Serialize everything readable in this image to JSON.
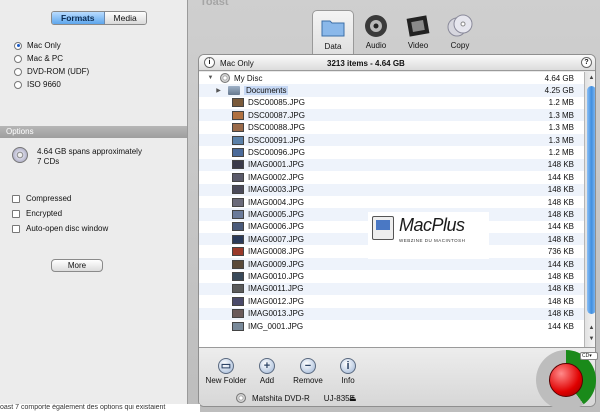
{
  "drawer": {
    "segments": [
      "Formats",
      "Media"
    ],
    "active_segment": "Formats",
    "formats": [
      {
        "label": "Mac Only",
        "selected": true
      },
      {
        "label": "Mac & PC",
        "selected": false
      },
      {
        "label": "DVD-ROM (UDF)",
        "selected": false
      },
      {
        "label": "ISO 9660",
        "selected": false
      }
    ],
    "options_title": "Options",
    "span_text": "4.64 GB spans approximately 7 CDs",
    "checks": [
      "Compressed",
      "Encrypted",
      "Auto-open disc window"
    ],
    "more_label": "More"
  },
  "caption": "oast 7 comporte également des options qui existaient",
  "window": {
    "title": "Toast",
    "tabs": [
      {
        "label": "Data",
        "icon": "folder-icon",
        "active": true
      },
      {
        "label": "Audio",
        "icon": "speaker-icon",
        "active": false
      },
      {
        "label": "Video",
        "icon": "film-icon",
        "active": false
      },
      {
        "label": "Copy",
        "icon": "discs-icon",
        "active": false
      }
    ]
  },
  "panel": {
    "format": "Mac Only",
    "summary": "3213 items - 4.64 GB",
    "help": "?",
    "info": "i"
  },
  "files": [
    {
      "name": "My Disc",
      "size": "4.64 GB",
      "kind": "disc"
    },
    {
      "name": "Documents",
      "size": "4.25 GB",
      "kind": "folder"
    },
    {
      "name": "DSC00085.JPG",
      "size": "1.2 MB",
      "kind": "image",
      "color": "#7a5a3a"
    },
    {
      "name": "DSC00087.JPG",
      "size": "1.3 MB",
      "kind": "image",
      "color": "#b07040"
    },
    {
      "name": "DSC00088.JPG",
      "size": "1.3 MB",
      "kind": "image",
      "color": "#9a6a4a"
    },
    {
      "name": "DSC00091.JPG",
      "size": "1.3 MB",
      "kind": "image",
      "color": "#5a80a8"
    },
    {
      "name": "DSC00096.JPG",
      "size": "1.2 MB",
      "kind": "image",
      "color": "#4a6a9a"
    },
    {
      "name": "IMAG0001.JPG",
      "size": "148 KB",
      "kind": "image",
      "color": "#3a3a4a"
    },
    {
      "name": "IMAG0002.JPG",
      "size": "144 KB",
      "kind": "image",
      "color": "#5a5a6a"
    },
    {
      "name": "IMAG0003.JPG",
      "size": "148 KB",
      "kind": "image",
      "color": "#4a4a5a"
    },
    {
      "name": "IMAG0004.JPG",
      "size": "148 KB",
      "kind": "image",
      "color": "#6a6a7a"
    },
    {
      "name": "IMAG0005.JPG",
      "size": "148 KB",
      "kind": "image",
      "color": "#6a7a9a"
    },
    {
      "name": "IMAG0006.JPG",
      "size": "144 KB",
      "kind": "image",
      "color": "#4a5a7a"
    },
    {
      "name": "IMAG0007.JPG",
      "size": "148 KB",
      "kind": "image",
      "color": "#2a3a5a"
    },
    {
      "name": "IMAG0008.JPG",
      "size": "736 KB",
      "kind": "image",
      "color": "#9a3a2a"
    },
    {
      "name": "IMAG0009.JPG",
      "size": "144 KB",
      "kind": "image",
      "color": "#5a4a3a"
    },
    {
      "name": "IMAG0010.JPG",
      "size": "148 KB",
      "kind": "image",
      "color": "#3a4a5a"
    },
    {
      "name": "IMAG0011.JPG",
      "size": "148 KB",
      "kind": "image",
      "color": "#5a5a5a"
    },
    {
      "name": "IMAG0012.JPG",
      "size": "148 KB",
      "kind": "image",
      "color": "#4a4a6a"
    },
    {
      "name": "IMAG0013.JPG",
      "size": "148 KB",
      "kind": "image",
      "color": "#6a5a5a"
    },
    {
      "name": "IMG_0001.JPG",
      "size": "144 KB",
      "kind": "image",
      "color": "#7a8a9a"
    }
  ],
  "toolbar": [
    {
      "label": "New Folder",
      "icon": "new-folder-icon",
      "glyph": "▭"
    },
    {
      "label": "Add",
      "icon": "add-icon",
      "glyph": "+"
    },
    {
      "label": "Remove",
      "icon": "remove-icon",
      "glyph": "−"
    },
    {
      "label": "Info",
      "icon": "info-icon",
      "glyph": "i"
    }
  ],
  "logo": {
    "name": "MacPlus",
    "tagline": "WEBZINE DU MACINTOSH"
  },
  "status": {
    "drive": "Matshita DVD-R",
    "model": "UJ-835E"
  },
  "media_select": "CD",
  "burn": {
    "progress": 0.4
  }
}
